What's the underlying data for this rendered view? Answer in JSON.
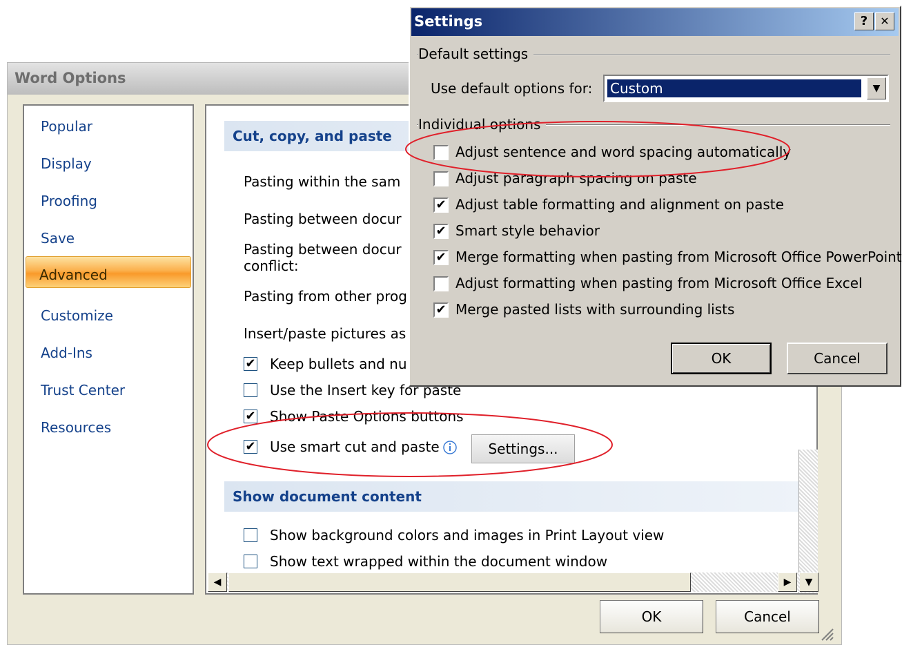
{
  "word_options": {
    "title": "Word Options",
    "nav": [
      {
        "label": "Popular"
      },
      {
        "label": "Display"
      },
      {
        "label": "Proofing"
      },
      {
        "label": "Save"
      },
      {
        "label": "Advanced",
        "selected": true
      },
      {
        "label": "Customize"
      },
      {
        "label": "Add-Ins"
      },
      {
        "label": "Trust Center"
      },
      {
        "label": "Resources"
      }
    ],
    "section_cut_copy_paste": "Cut, copy, and paste",
    "paste_rows": [
      "Pasting within the sam",
      "Pasting between docur",
      "Pasting between docur",
      "conflict:",
      "Pasting from other prog",
      "Insert/paste pictures as"
    ],
    "checkbox_rows": [
      {
        "label": "Keep bullets and nu",
        "checked": true
      },
      {
        "label": "Use the Insert key for paste",
        "checked": false
      },
      {
        "label": "Show Paste Options buttons",
        "checked": true
      },
      {
        "label": "Use smart cut and paste",
        "checked": true
      }
    ],
    "info_icon": "info-icon",
    "settings_button": "Settings...",
    "section_show_document": "Show document content",
    "show_rows": [
      {
        "label": "Show background colors and images in Print Layout view",
        "checked": false
      },
      {
        "label": "Show text wrapped within the document window",
        "checked": false
      }
    ],
    "ok": "OK",
    "cancel": "Cancel"
  },
  "settings_dialog": {
    "title": "Settings",
    "help_glyph": "?",
    "close_glyph": "✕",
    "group_default": "Default settings",
    "use_default_label": "Use default options for:",
    "use_default_value": "Custom",
    "group_individual": "Individual options",
    "options": [
      {
        "label": "Adjust sentence and word spacing automatically",
        "checked": false
      },
      {
        "label": "Adjust paragraph spacing on paste",
        "checked": false
      },
      {
        "label": "Adjust table formatting and alignment on paste",
        "checked": true
      },
      {
        "label": "Smart style behavior",
        "checked": true
      },
      {
        "label": "Merge formatting when pasting from Microsoft Office PowerPoint",
        "checked": true
      },
      {
        "label": "Adjust formatting when pasting from Microsoft Office Excel",
        "checked": false
      },
      {
        "label": "Merge pasted lists with surrounding lists",
        "checked": true
      }
    ],
    "ok": "OK",
    "cancel": "Cancel"
  },
  "colors": {
    "nav_text": "#15428b",
    "selected_nav": "#fbb04c",
    "annotation": "#e0202a",
    "settings_title_bar": "#0a246a"
  }
}
